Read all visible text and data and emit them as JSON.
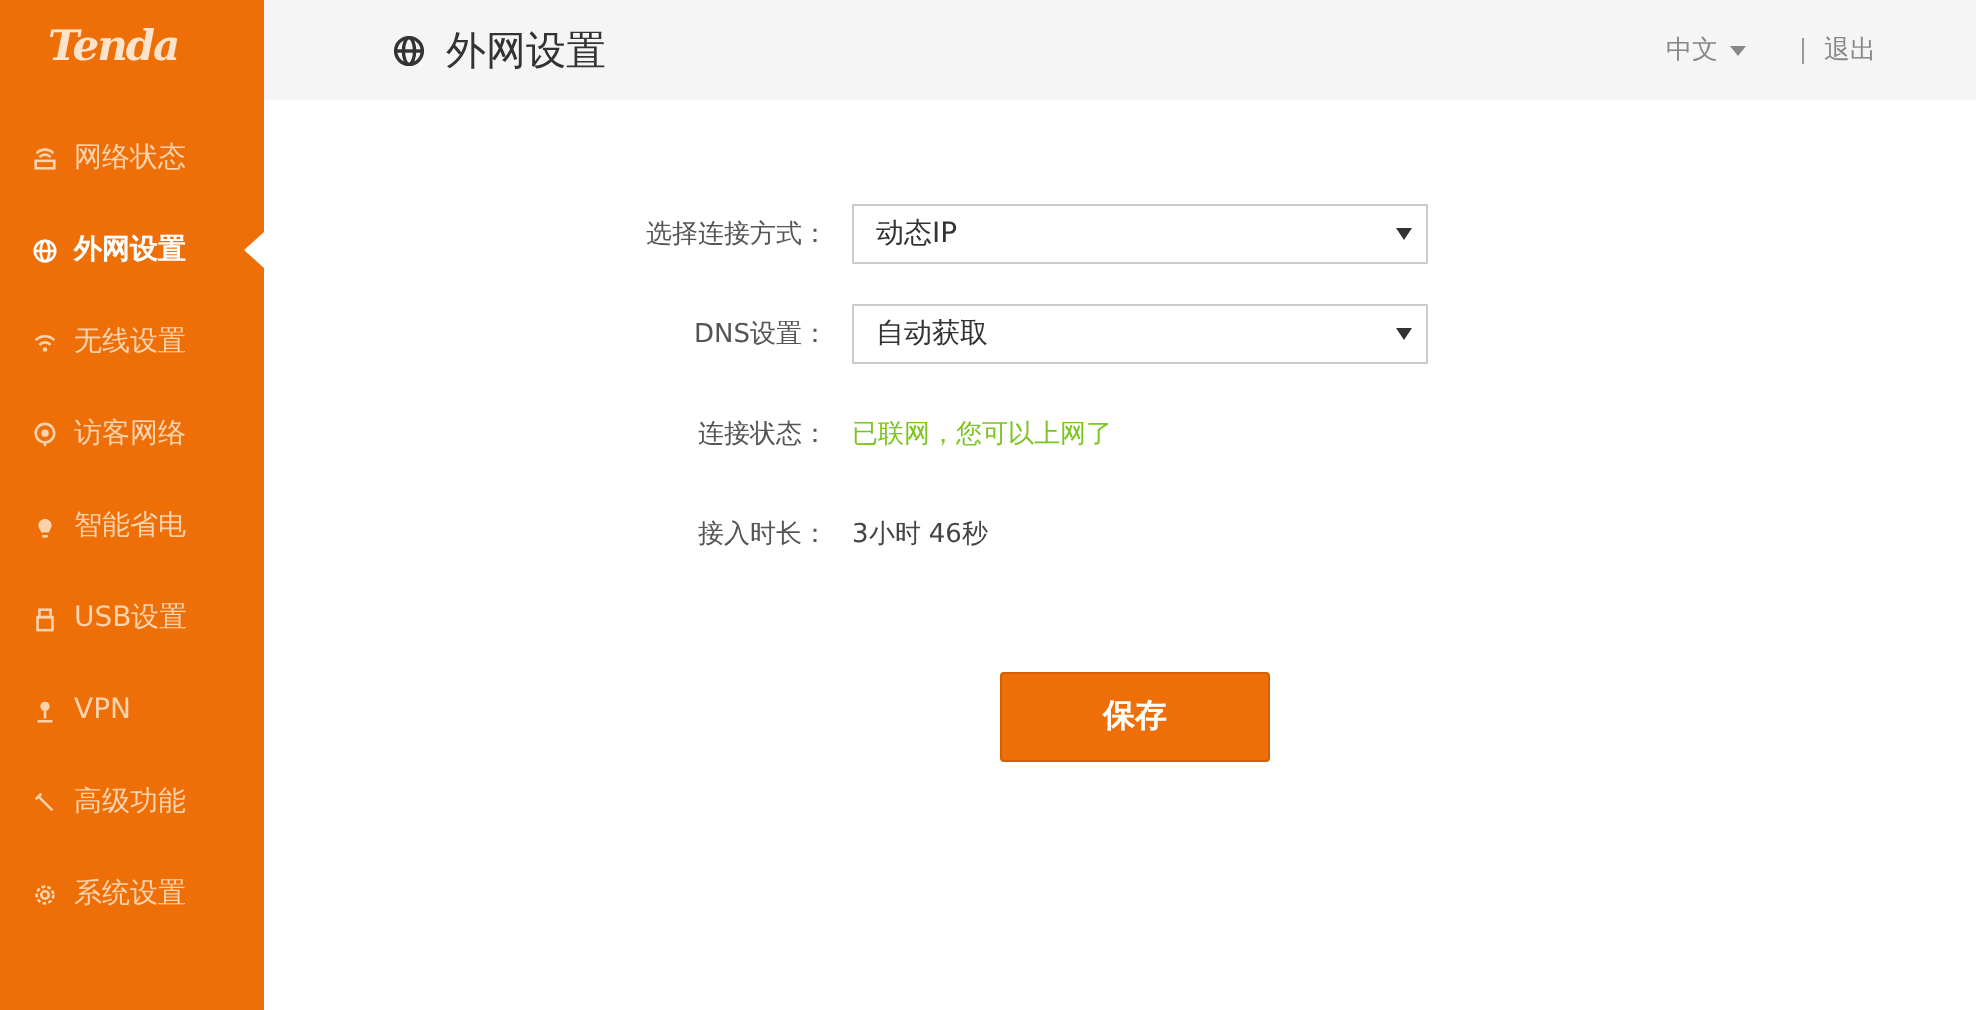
{
  "logo": "Tenda",
  "nav": [
    {
      "label": "网络状态",
      "selected": false
    },
    {
      "label": "外网设置",
      "selected": true
    },
    {
      "label": "无线设置",
      "selected": false
    },
    {
      "label": "访客网络",
      "selected": false
    },
    {
      "label": "智能省电",
      "selected": false
    },
    {
      "label": "USB设置",
      "selected": false
    },
    {
      "label": "VPN",
      "selected": false
    },
    {
      "label": "高级功能",
      "selected": false
    },
    {
      "label": "系统设置",
      "selected": false
    }
  ],
  "header": {
    "title": "外网设置",
    "language": "中文",
    "logout": "退出"
  },
  "form": [
    {
      "kind": "select",
      "label": "选择连接方式：",
      "value": "动态IP"
    },
    {
      "kind": "select",
      "label": "DNS设置：",
      "value": "自动获取"
    },
    {
      "kind": "status",
      "label": "连接状态：",
      "value": "已联网，您可以上网了"
    },
    {
      "kind": "text",
      "label": "接入时长：",
      "value": "3小时 46秒"
    }
  ],
  "save": "保存"
}
